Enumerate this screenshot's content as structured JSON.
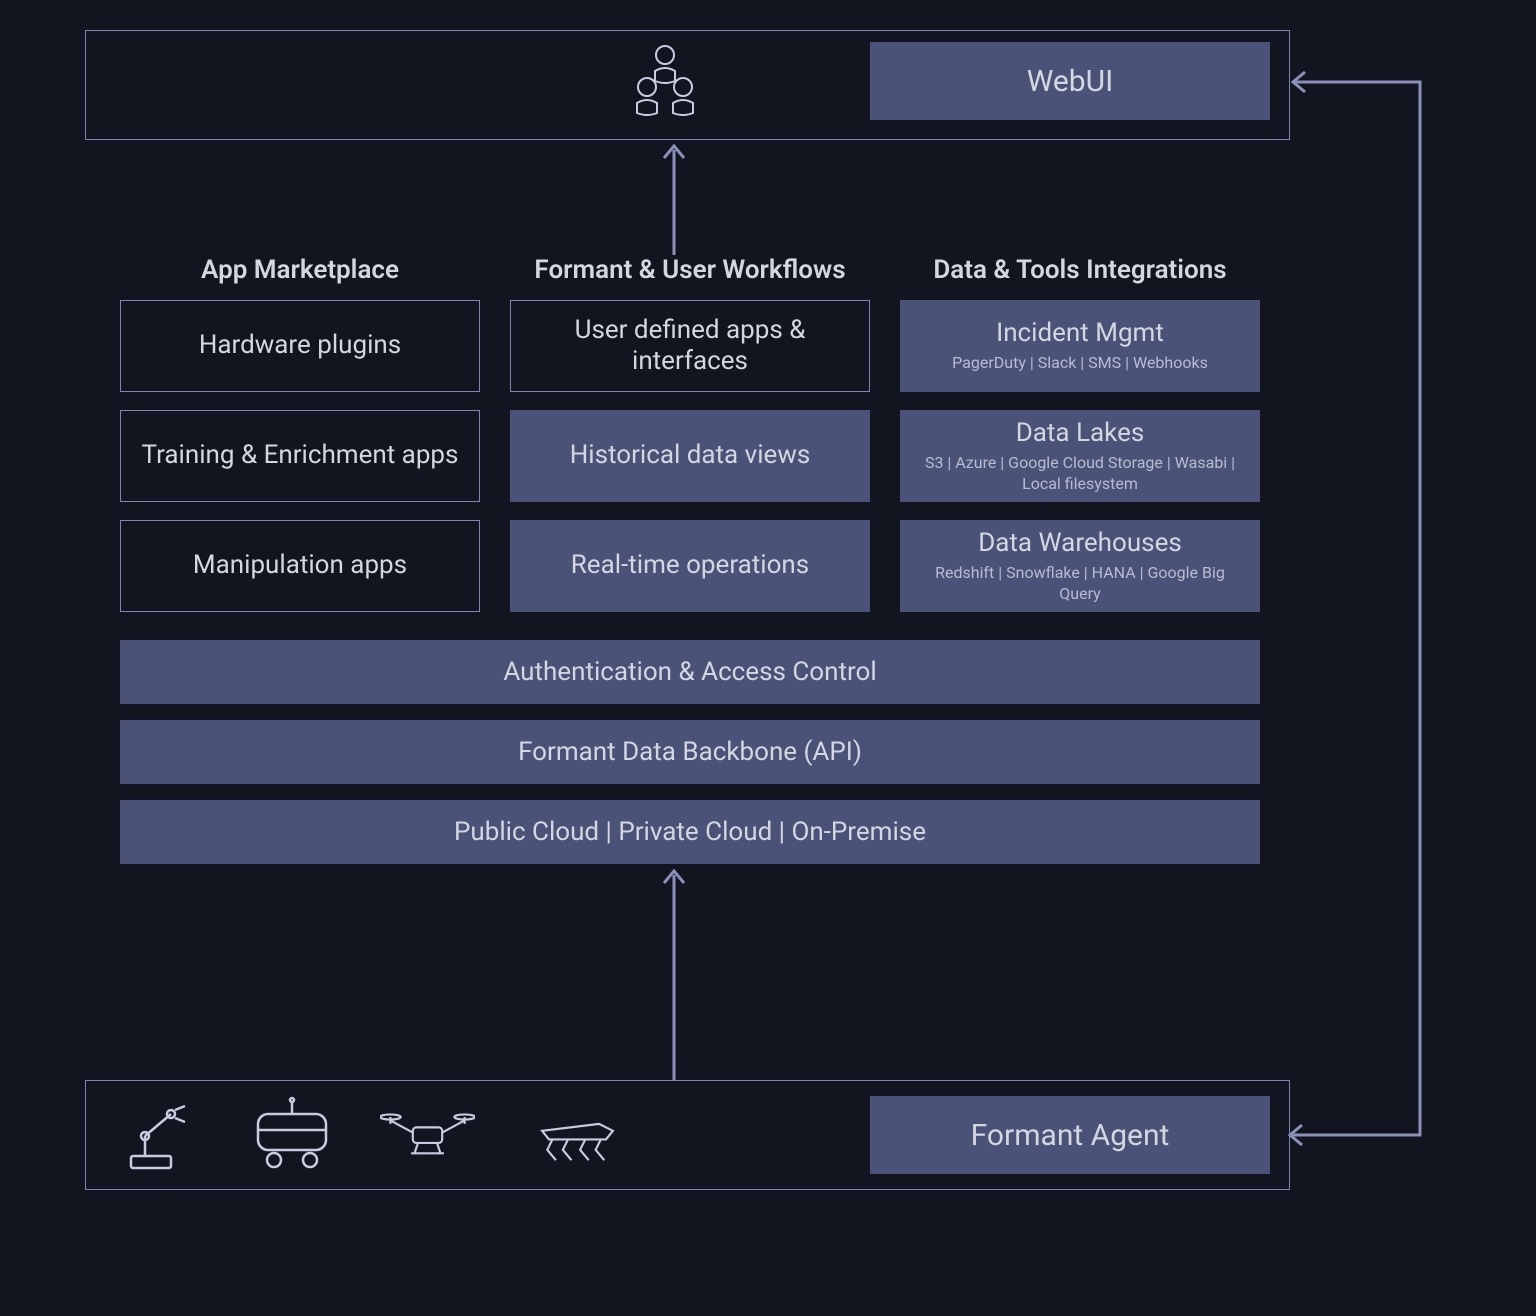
{
  "top": {
    "webui_label": "WebUI"
  },
  "columns": {
    "col1": {
      "heading": "App Marketplace",
      "boxes": [
        {
          "title": "Hardware plugins",
          "sub": ""
        },
        {
          "title": "Training & Enrichment apps",
          "sub": ""
        },
        {
          "title": "Manipulation apps",
          "sub": ""
        }
      ]
    },
    "col2": {
      "heading": "Formant & User Workflows",
      "boxes": [
        {
          "title": "User defined apps & interfaces",
          "sub": ""
        },
        {
          "title": "Historical data views",
          "sub": ""
        },
        {
          "title": "Real-time operations",
          "sub": ""
        }
      ]
    },
    "col3": {
      "heading": "Data & Tools Integrations",
      "boxes": [
        {
          "title": "Incident Mgmt",
          "sub": "PagerDuty | Slack | SMS | Webhooks"
        },
        {
          "title": "Data Lakes",
          "sub": "S3 | Azure | Google Cloud Storage | Wasabi | Local filesystem"
        },
        {
          "title": "Data Warehouses",
          "sub": "Redshift | Snowflake | HANA | Google Big Query"
        }
      ]
    }
  },
  "bars": {
    "auth": "Authentication & Access Control",
    "backbone": "Formant Data Backbone (API)",
    "deploy": "Public Cloud   |  Private Cloud  |  On-Premise"
  },
  "bottom": {
    "agent_label": "Formant Agent"
  }
}
